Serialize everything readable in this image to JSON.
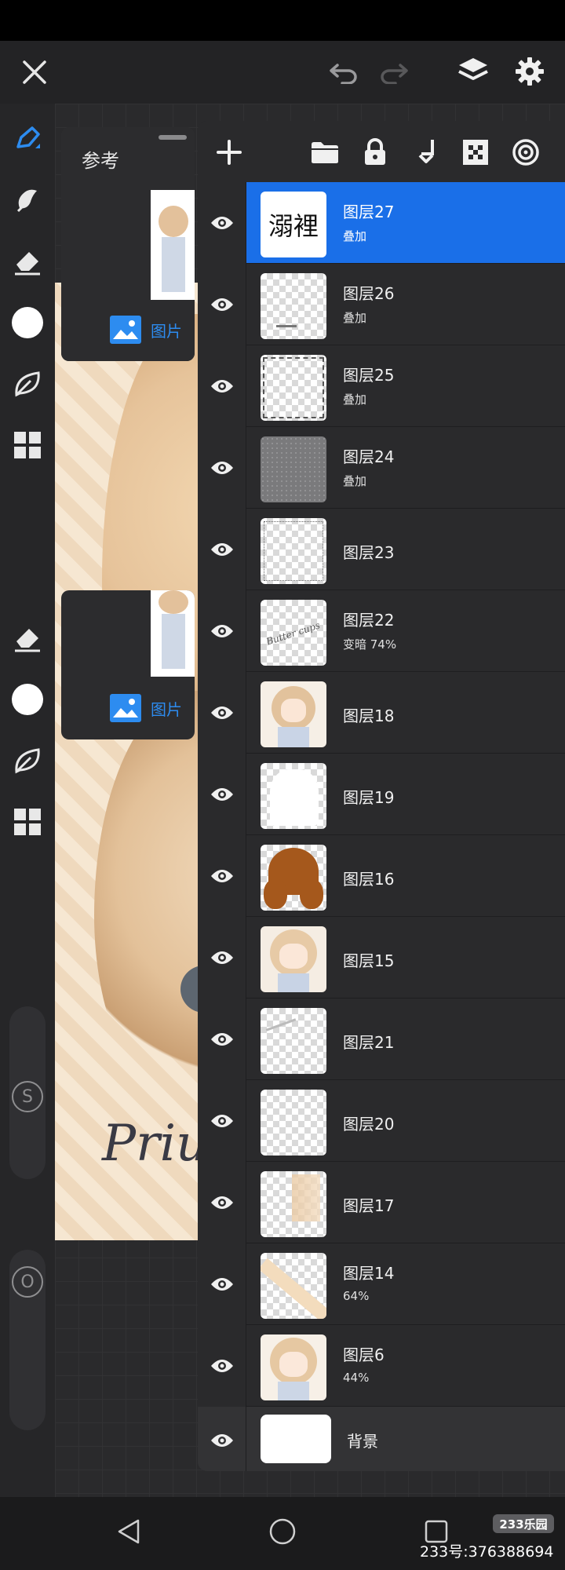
{
  "reference": {
    "title": "参考",
    "image_label": "图片"
  },
  "layers": [
    {
      "name": "图层27",
      "mode": "叠加",
      "thumb_text": "溺裡",
      "selected": true
    },
    {
      "name": "图层26",
      "mode": "叠加"
    },
    {
      "name": "图层25",
      "mode": "叠加"
    },
    {
      "name": "图层24",
      "mode": "叠加"
    },
    {
      "name": "图层23",
      "mode": ""
    },
    {
      "name": "图层22",
      "mode": "变暗  74%",
      "thumb_text": "Butter cups"
    },
    {
      "name": "图层18",
      "mode": ""
    },
    {
      "name": "图层19",
      "mode": ""
    },
    {
      "name": "图层16",
      "mode": ""
    },
    {
      "name": "图层15",
      "mode": ""
    },
    {
      "name": "图层21",
      "mode": ""
    },
    {
      "name": "图层20",
      "mode": ""
    },
    {
      "name": "图层17",
      "mode": ""
    },
    {
      "name": "图层14",
      "mode": "64%"
    },
    {
      "name": "图层6",
      "mode": "44%"
    },
    {
      "name": "背景",
      "mode": ""
    }
  ],
  "side_toolbar": {
    "size_badge": "S",
    "opacity_badge": "O"
  },
  "watermark": {
    "logo": "233乐园",
    "id_text": "233号:376388694"
  },
  "colors": {
    "accent": "#1a6fe8",
    "panel": "#2a2a2c",
    "toolbar": "#232325"
  }
}
